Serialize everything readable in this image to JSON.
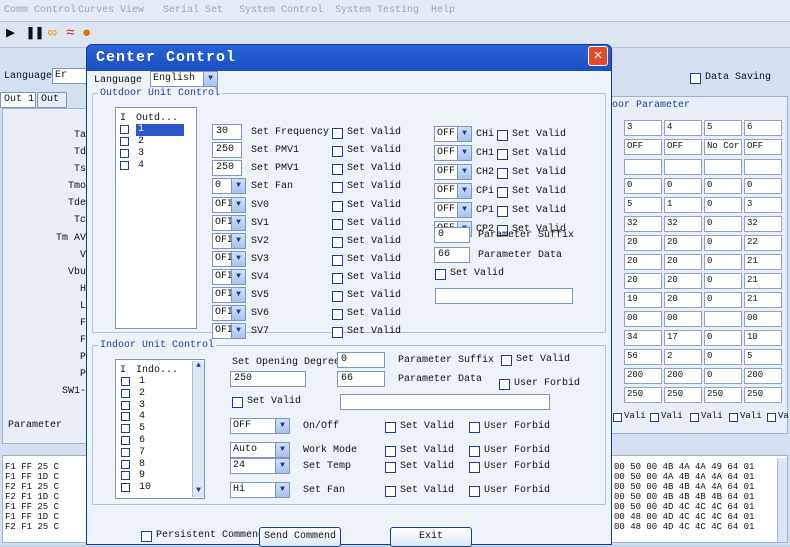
{
  "menubar": [
    "Comm Control",
    "Curves View",
    "Serial Set",
    "System Control",
    "System Testing",
    "Help"
  ],
  "bg": {
    "language_label": "Language",
    "language_value": "Er",
    "tabs": [
      "Out 1",
      "Out"
    ],
    "row_labels": [
      "Ta",
      "Td",
      "Ts",
      "Tmo",
      "Tde",
      "Tc",
      "Tm AV",
      "V",
      "Vbu",
      "H",
      "L",
      "F",
      "F",
      "P",
      "P",
      "SW1-"
    ],
    "parameter_label": "Parameter",
    "data_saving": "Data Saving",
    "outdoor_param_title": "door Parameter",
    "grid": [
      [
        "3",
        "4",
        "5",
        "6"
      ],
      [
        "OFF",
        "OFF",
        "No Cor",
        "OFF"
      ],
      [
        "",
        "",
        "",
        ""
      ],
      [
        "0",
        "0",
        "0",
        "0"
      ],
      [
        "5",
        "1",
        "0",
        "3"
      ],
      [
        "32",
        "32",
        "0",
        "32"
      ],
      [
        "20",
        "20",
        "0",
        "22"
      ],
      [
        "20",
        "20",
        "0",
        "21"
      ],
      [
        "20",
        "20",
        "0",
        "21"
      ],
      [
        "19",
        "20",
        "0",
        "21"
      ],
      [
        "00",
        "00",
        "",
        "00"
      ],
      [
        "34",
        "17",
        "0",
        "10"
      ],
      [
        "56",
        "2",
        "0",
        "5"
      ],
      [
        "200",
        "200",
        "0",
        "200"
      ],
      [
        "250",
        "250",
        "250",
        "250"
      ]
    ],
    "valid_label": "Vali",
    "log_left": [
      "F1 FF 25 C",
      "F1 FF 1D C",
      "F2 F1 25 C",
      "F2 F1 1D C",
      "F1 FF 25 C",
      "F1 FF 1D C",
      "F2 F1 25 C"
    ],
    "log_right": [
      "00 50 00 4B 4A 4A 49 64 01",
      "00 50 00 4A 4B 4A 4A 64 01",
      "00 50 00 4B 4B 4A 4A 64 01",
      "00 50 00 4B 4B 4B 4B 64 01",
      "00 50 00 4D 4C 4C 4C 64 01",
      "00 48 00 4D 4C 4C 4C 64 01",
      "00 48 00 4D 4C 4C 4C 64 01"
    ]
  },
  "dialog": {
    "title": "Center Control",
    "language_label": "Language",
    "language_value": "English",
    "outdoor_group": "Outdoor Unit Control",
    "outdoor_list_header": [
      "I",
      "Outd..."
    ],
    "outdoor_list": [
      "1",
      "2",
      "3",
      "4"
    ],
    "left_rows": [
      {
        "value": "30",
        "type": "text",
        "label": "Set Frequency"
      },
      {
        "value": "250",
        "type": "text",
        "label": "Set PMV1"
      },
      {
        "value": "250",
        "type": "text",
        "label": "Set PMV1"
      },
      {
        "value": "0",
        "type": "combo",
        "label": "Set Fan"
      },
      {
        "value": "OFI",
        "type": "combo",
        "label": "SV0"
      },
      {
        "value": "OFI",
        "type": "combo",
        "label": "SV1"
      },
      {
        "value": "OFI",
        "type": "combo",
        "label": "SV2"
      },
      {
        "value": "OFI",
        "type": "combo",
        "label": "SV3"
      },
      {
        "value": "OFI",
        "type": "combo",
        "label": "SV4"
      },
      {
        "value": "OFI",
        "type": "combo",
        "label": "SV5"
      },
      {
        "value": "OFI",
        "type": "combo",
        "label": "SV6"
      },
      {
        "value": "OFI",
        "type": "combo",
        "label": "SV7"
      }
    ],
    "set_valid": "Set Valid",
    "right_rows": [
      {
        "value": "OFF",
        "label": "CHi"
      },
      {
        "value": "OFF",
        "label": "CH1"
      },
      {
        "value": "OFF",
        "label": "CH2"
      },
      {
        "value": "OFF",
        "label": "CPi"
      },
      {
        "value": "OFF",
        "label": "CP1"
      },
      {
        "value": "OFF",
        "label": "CP2"
      }
    ],
    "param_suffix_value": "0",
    "param_suffix_label": "Parameter Suffix",
    "param_data_value": "66",
    "param_data_label": "Parameter Data",
    "indoor_group": "Indoor Unit Control",
    "indoor_list_header": [
      "I",
      "Indo..."
    ],
    "indoor_list": [
      "1",
      "2",
      "3",
      "4",
      "5",
      "6",
      "7",
      "8",
      "9",
      "10"
    ],
    "set_opening_label": "Set Opening Degree",
    "opening_value": "0",
    "opening_value2": "250",
    "indoor_suffix_label": "Parameter Suffix",
    "indoor_data_value": "66",
    "indoor_data_label": "Parameter Data",
    "user_forbid": "User Forbid",
    "indoor_rows": [
      {
        "value": "OFF",
        "label": "On/Off"
      },
      {
        "value": "Auto",
        "label": "Work Mode"
      },
      {
        "value": "24",
        "label": "Set Temp"
      },
      {
        "value": "Hi",
        "label": "Set Fan"
      }
    ],
    "persistent_label": "Persistent Commend",
    "send_label": "Send Commend",
    "exit_label": "Exit"
  }
}
